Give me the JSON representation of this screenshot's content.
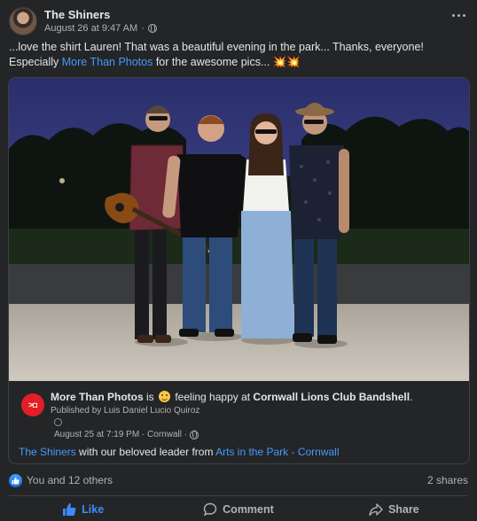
{
  "post": {
    "author": "The Shiners",
    "timestamp": "August 26 at 9:47 AM",
    "caption_text": "...love the shirt Lauren! That was a beautiful evening in the park... Thanks, everyone! Especially ",
    "caption_link": "More Than Photos",
    "caption_tail": " for the awesome pics... 💥💥"
  },
  "shared": {
    "page_name": "More Than Photos",
    "is_text": " is ",
    "feeling_text": " feeling happy at ",
    "place": "Cornwall Lions Club Bandshell",
    "place_tail": ".",
    "published_by": "Published by Luis Daniel Lucio Quiroz",
    "date_location": "August 25 at 7:19 PM · Cornwall ·",
    "tagged": "The Shiners",
    "desc_middle": " with our beloved leader  from ",
    "album": "Arts in the Park - Cornwall"
  },
  "reactions": {
    "summary": "You and 12 others",
    "shares": "2 shares"
  },
  "actions": {
    "like": "Like",
    "comment": "Comment",
    "share": "Share"
  },
  "colors": {
    "background": "#242526",
    "link": "#4599ff",
    "liked": "#3e8bff",
    "page_logo": "#e41e26"
  }
}
